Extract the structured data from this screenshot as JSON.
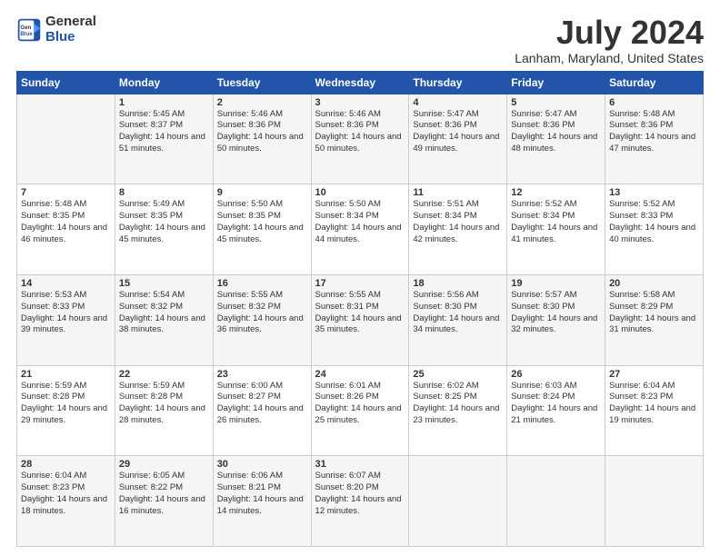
{
  "logo": {
    "general": "General",
    "blue": "Blue"
  },
  "header": {
    "month": "July 2024",
    "location": "Lanham, Maryland, United States"
  },
  "columns": [
    "Sunday",
    "Monday",
    "Tuesday",
    "Wednesday",
    "Thursday",
    "Friday",
    "Saturday"
  ],
  "weeks": [
    [
      {
        "day": "",
        "sunrise": "",
        "sunset": "",
        "daylight": ""
      },
      {
        "day": "1",
        "sunrise": "Sunrise: 5:45 AM",
        "sunset": "Sunset: 8:37 PM",
        "daylight": "Daylight: 14 hours and 51 minutes."
      },
      {
        "day": "2",
        "sunrise": "Sunrise: 5:46 AM",
        "sunset": "Sunset: 8:36 PM",
        "daylight": "Daylight: 14 hours and 50 minutes."
      },
      {
        "day": "3",
        "sunrise": "Sunrise: 5:46 AM",
        "sunset": "Sunset: 8:36 PM",
        "daylight": "Daylight: 14 hours and 50 minutes."
      },
      {
        "day": "4",
        "sunrise": "Sunrise: 5:47 AM",
        "sunset": "Sunset: 8:36 PM",
        "daylight": "Daylight: 14 hours and 49 minutes."
      },
      {
        "day": "5",
        "sunrise": "Sunrise: 5:47 AM",
        "sunset": "Sunset: 8:36 PM",
        "daylight": "Daylight: 14 hours and 48 minutes."
      },
      {
        "day": "6",
        "sunrise": "Sunrise: 5:48 AM",
        "sunset": "Sunset: 8:36 PM",
        "daylight": "Daylight: 14 hours and 47 minutes."
      }
    ],
    [
      {
        "day": "7",
        "sunrise": "Sunrise: 5:48 AM",
        "sunset": "Sunset: 8:35 PM",
        "daylight": "Daylight: 14 hours and 46 minutes."
      },
      {
        "day": "8",
        "sunrise": "Sunrise: 5:49 AM",
        "sunset": "Sunset: 8:35 PM",
        "daylight": "Daylight: 14 hours and 45 minutes."
      },
      {
        "day": "9",
        "sunrise": "Sunrise: 5:50 AM",
        "sunset": "Sunset: 8:35 PM",
        "daylight": "Daylight: 14 hours and 45 minutes."
      },
      {
        "day": "10",
        "sunrise": "Sunrise: 5:50 AM",
        "sunset": "Sunset: 8:34 PM",
        "daylight": "Daylight: 14 hours and 44 minutes."
      },
      {
        "day": "11",
        "sunrise": "Sunrise: 5:51 AM",
        "sunset": "Sunset: 8:34 PM",
        "daylight": "Daylight: 14 hours and 42 minutes."
      },
      {
        "day": "12",
        "sunrise": "Sunrise: 5:52 AM",
        "sunset": "Sunset: 8:34 PM",
        "daylight": "Daylight: 14 hours and 41 minutes."
      },
      {
        "day": "13",
        "sunrise": "Sunrise: 5:52 AM",
        "sunset": "Sunset: 8:33 PM",
        "daylight": "Daylight: 14 hours and 40 minutes."
      }
    ],
    [
      {
        "day": "14",
        "sunrise": "Sunrise: 5:53 AM",
        "sunset": "Sunset: 8:33 PM",
        "daylight": "Daylight: 14 hours and 39 minutes."
      },
      {
        "day": "15",
        "sunrise": "Sunrise: 5:54 AM",
        "sunset": "Sunset: 8:32 PM",
        "daylight": "Daylight: 14 hours and 38 minutes."
      },
      {
        "day": "16",
        "sunrise": "Sunrise: 5:55 AM",
        "sunset": "Sunset: 8:32 PM",
        "daylight": "Daylight: 14 hours and 36 minutes."
      },
      {
        "day": "17",
        "sunrise": "Sunrise: 5:55 AM",
        "sunset": "Sunset: 8:31 PM",
        "daylight": "Daylight: 14 hours and 35 minutes."
      },
      {
        "day": "18",
        "sunrise": "Sunrise: 5:56 AM",
        "sunset": "Sunset: 8:30 PM",
        "daylight": "Daylight: 14 hours and 34 minutes."
      },
      {
        "day": "19",
        "sunrise": "Sunrise: 5:57 AM",
        "sunset": "Sunset: 8:30 PM",
        "daylight": "Daylight: 14 hours and 32 minutes."
      },
      {
        "day": "20",
        "sunrise": "Sunrise: 5:58 AM",
        "sunset": "Sunset: 8:29 PM",
        "daylight": "Daylight: 14 hours and 31 minutes."
      }
    ],
    [
      {
        "day": "21",
        "sunrise": "Sunrise: 5:59 AM",
        "sunset": "Sunset: 8:28 PM",
        "daylight": "Daylight: 14 hours and 29 minutes."
      },
      {
        "day": "22",
        "sunrise": "Sunrise: 5:59 AM",
        "sunset": "Sunset: 8:28 PM",
        "daylight": "Daylight: 14 hours and 28 minutes."
      },
      {
        "day": "23",
        "sunrise": "Sunrise: 6:00 AM",
        "sunset": "Sunset: 8:27 PM",
        "daylight": "Daylight: 14 hours and 26 minutes."
      },
      {
        "day": "24",
        "sunrise": "Sunrise: 6:01 AM",
        "sunset": "Sunset: 8:26 PM",
        "daylight": "Daylight: 14 hours and 25 minutes."
      },
      {
        "day": "25",
        "sunrise": "Sunrise: 6:02 AM",
        "sunset": "Sunset: 8:25 PM",
        "daylight": "Daylight: 14 hours and 23 minutes."
      },
      {
        "day": "26",
        "sunrise": "Sunrise: 6:03 AM",
        "sunset": "Sunset: 8:24 PM",
        "daylight": "Daylight: 14 hours and 21 minutes."
      },
      {
        "day": "27",
        "sunrise": "Sunrise: 6:04 AM",
        "sunset": "Sunset: 8:23 PM",
        "daylight": "Daylight: 14 hours and 19 minutes."
      }
    ],
    [
      {
        "day": "28",
        "sunrise": "Sunrise: 6:04 AM",
        "sunset": "Sunset: 8:23 PM",
        "daylight": "Daylight: 14 hours and 18 minutes."
      },
      {
        "day": "29",
        "sunrise": "Sunrise: 6:05 AM",
        "sunset": "Sunset: 8:22 PM",
        "daylight": "Daylight: 14 hours and 16 minutes."
      },
      {
        "day": "30",
        "sunrise": "Sunrise: 6:06 AM",
        "sunset": "Sunset: 8:21 PM",
        "daylight": "Daylight: 14 hours and 14 minutes."
      },
      {
        "day": "31",
        "sunrise": "Sunrise: 6:07 AM",
        "sunset": "Sunset: 8:20 PM",
        "daylight": "Daylight: 14 hours and 12 minutes."
      },
      {
        "day": "",
        "sunrise": "",
        "sunset": "",
        "daylight": ""
      },
      {
        "day": "",
        "sunrise": "",
        "sunset": "",
        "daylight": ""
      },
      {
        "day": "",
        "sunrise": "",
        "sunset": "",
        "daylight": ""
      }
    ]
  ]
}
